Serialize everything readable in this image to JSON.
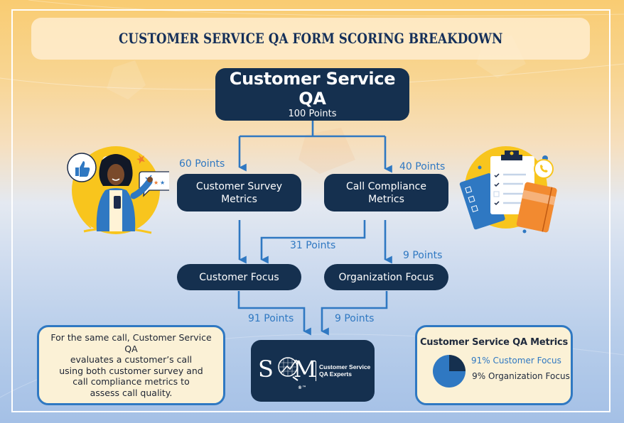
{
  "title": "CUSTOMER SERVICE QA FORM SCORING BREAKDOWN",
  "root": {
    "label": "Customer Service QA",
    "points": "100 Points"
  },
  "branches": {
    "survey": {
      "label_line1": "Customer Survey",
      "label_line2": "Metrics",
      "points": "60 Points"
    },
    "compliance": {
      "label_line1": "Call Compliance",
      "label_line2": "Metrics",
      "points": "40 Points"
    }
  },
  "focus": {
    "customer": {
      "label": "Customer Focus",
      "cross_points": "31 Points"
    },
    "organization": {
      "label": "Organization Focus",
      "points": "9 Points"
    }
  },
  "outputs": {
    "customer_points": "91 Points",
    "organization_points": "9 Points"
  },
  "note": {
    "lines": [
      "For the same call, Customer Service QA",
      "evaluates a customer’s call",
      "using both customer survey and",
      "call compliance metrics to",
      "assess call quality."
    ]
  },
  "logo": {
    "mark": "SQM",
    "tagline_line1": "Customer Service",
    "tagline_line2": "QA Experts",
    "trademark": "®™"
  },
  "metrics_card": {
    "title": "Customer Service QA Metrics",
    "customer_label": "91% Customer Focus",
    "organization_label": "9% Organization Focus",
    "pie": [
      {
        "name": "Customer Focus",
        "percent": 91,
        "color": "#2f78c2"
      },
      {
        "name": "Organization Focus",
        "percent": 9,
        "color": "#15304f"
      }
    ],
    "pie_drawn_dark_fraction": 0.25
  },
  "colors": {
    "navy": "#15304f",
    "accent_blue": "#2f78c2",
    "note_bg": "#fbf1d6",
    "title_text": "#15305a"
  },
  "illustrations": {
    "left": "person-with-phone-thumbs-up-icon",
    "right": "clipboard-checklist-notebook-icon"
  }
}
